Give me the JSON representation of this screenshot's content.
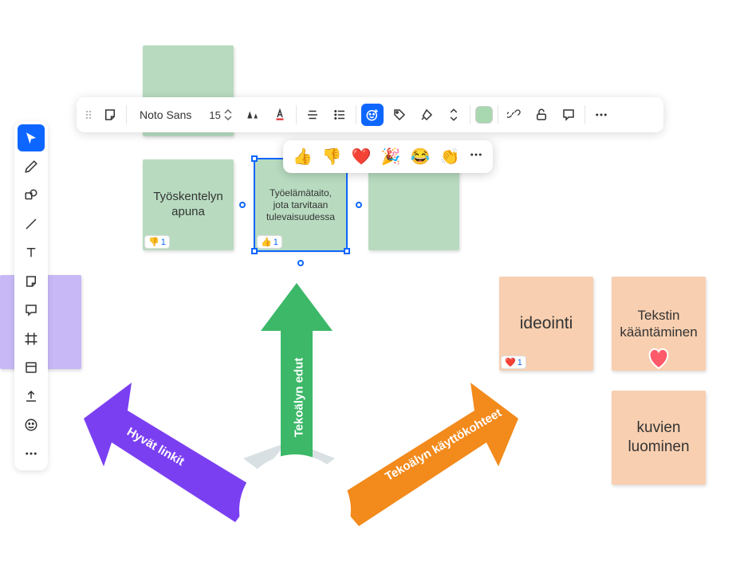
{
  "toolbar": {
    "font_name": "Noto Sans",
    "font_size": "15"
  },
  "emoji_options": [
    "👍",
    "👎",
    "❤️",
    "🎉",
    "😂",
    "👏"
  ],
  "notes": {
    "green1_text": "",
    "green2_text": "Työskentelyn apuna",
    "green2_badge_emoji": "👎",
    "green2_badge_count": "1",
    "green3_text": "Työelämätaito, jota tarvitaan tulevaisuudessa",
    "green3_badge_emoji": "👍",
    "green3_badge_count": "1",
    "green4_text": "",
    "orange1_text": "ideointi",
    "orange1_badge_emoji": "❤️",
    "orange1_badge_count": "1",
    "orange2_text": "Tekstin kääntäminen",
    "orange3_text": "kuvien luominen"
  },
  "arrows": {
    "purple_label": "Hyvät linkit",
    "green_label": "Tekoälyn edut",
    "orange_label": "Tekoälyn käyttökohteet"
  }
}
